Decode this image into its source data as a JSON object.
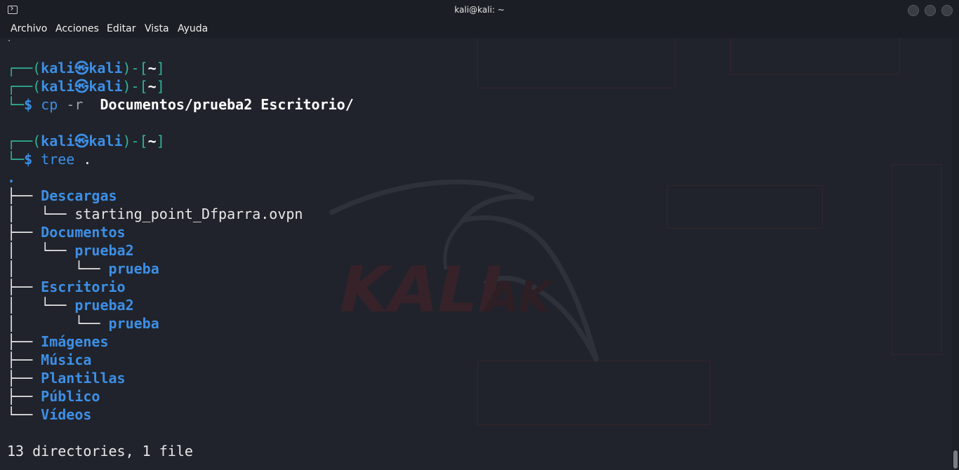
{
  "window": {
    "title": "kali@kali: ~",
    "icons": {
      "app": "terminal-icon",
      "minimize": "minimize-icon",
      "maximize": "maximize-icon",
      "close": "close-icon"
    }
  },
  "menu": [
    "Archivo",
    "Acciones",
    "Editar",
    "Vista",
    "Ayuda"
  ],
  "prompt": {
    "open": "┌──(",
    "user": "kali",
    "at": "㉿",
    "host": "kali",
    "mid": ")-[",
    "dir": "~",
    "close": "]",
    "cont": "└─",
    "dollar": "$"
  },
  "commands": {
    "cp_cmd": "cp",
    "cp_flag": "-r",
    "cp_args": "Documentos/prueba2 Escritorio/",
    "tree_cmd": "tree",
    "tree_arg": "."
  },
  "tree": {
    "root": ".",
    "lines": [
      {
        "prefix": "├── ",
        "name": "Descargas",
        "dir": true
      },
      {
        "prefix": "│   └── ",
        "name": "starting_point_Dfparra.ovpn",
        "dir": false
      },
      {
        "prefix": "├── ",
        "name": "Documentos",
        "dir": true
      },
      {
        "prefix": "│   └── ",
        "name": "prueba2",
        "dir": true
      },
      {
        "prefix": "│       └── ",
        "name": "prueba",
        "dir": true
      },
      {
        "prefix": "├── ",
        "name": "Escritorio",
        "dir": true
      },
      {
        "prefix": "│   └── ",
        "name": "prueba2",
        "dir": true
      },
      {
        "prefix": "│       └── ",
        "name": "prueba",
        "dir": true
      },
      {
        "prefix": "├── ",
        "name": "Imágenes",
        "dir": true
      },
      {
        "prefix": "├── ",
        "name": "Música",
        "dir": true
      },
      {
        "prefix": "├── ",
        "name": "Plantillas",
        "dir": true
      },
      {
        "prefix": "├── ",
        "name": "Público",
        "dir": true
      },
      {
        "prefix": "└── ",
        "name": "Vídeos",
        "dir": true
      }
    ],
    "summary": "13 directories, 1 file"
  },
  "colors": {
    "prompt": "#2fb39a",
    "directory": "#3d8fe6",
    "text": "#e8e8e8",
    "background": "#20232b"
  }
}
